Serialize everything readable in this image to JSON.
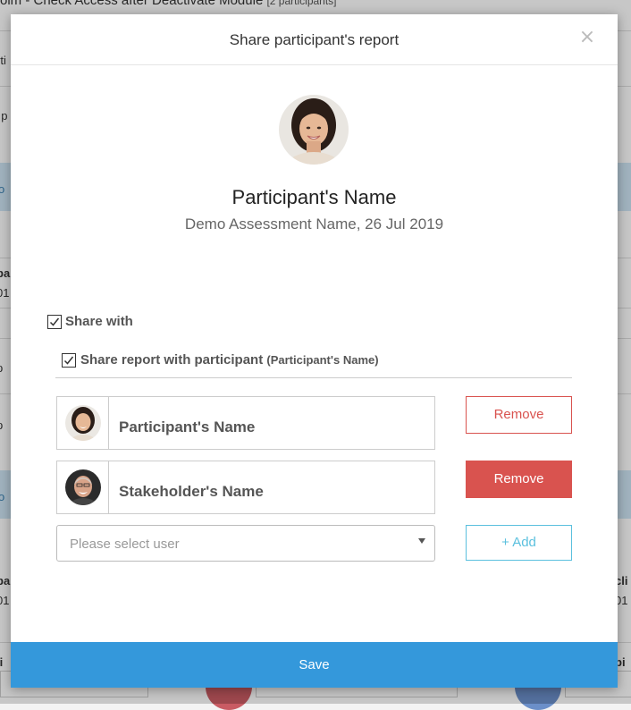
{
  "background": {
    "page_title": "oim - Check Access after Deactivate Module",
    "participants_badge": "[2 participants]",
    "frag_left_1": "rti",
    "frag_left_2": "I p",
    "frag_left_3": "o",
    "frag_left_4": "pa",
    "frag_left_5": "01",
    "frag_left_6": "p",
    "frag_left_7": "p",
    "frag_left_8": "o",
    "frag_left_9": "pa",
    "frag_left_10": "01",
    "frag_left_11": "li",
    "frag_right_1": "cli",
    "frag_right_2": "01",
    "frag_right_3": "pi"
  },
  "modal": {
    "title": "Share participant's report",
    "close_label": "×",
    "participant_name": "Participant's Name",
    "assessment_line": "Demo Assessment Name, 26 Jul 2019",
    "share_with_label": "Share with",
    "share_with_checked": true,
    "share_participant_label": "Share report with participant",
    "share_participant_name_hint": "(Participant's Name)",
    "share_participant_checked": true,
    "users": [
      {
        "name": "Participant's Name",
        "remove_label": "Remove",
        "remove_style": "outline"
      },
      {
        "name": "Stakeholder's Name",
        "remove_label": "Remove",
        "remove_style": "solid"
      }
    ],
    "select_placeholder": "Please select user",
    "add_label": "+ Add",
    "save_label": "Save"
  },
  "colors": {
    "danger": "#d9534f",
    "info": "#5bc0de",
    "primary": "#3498db"
  }
}
